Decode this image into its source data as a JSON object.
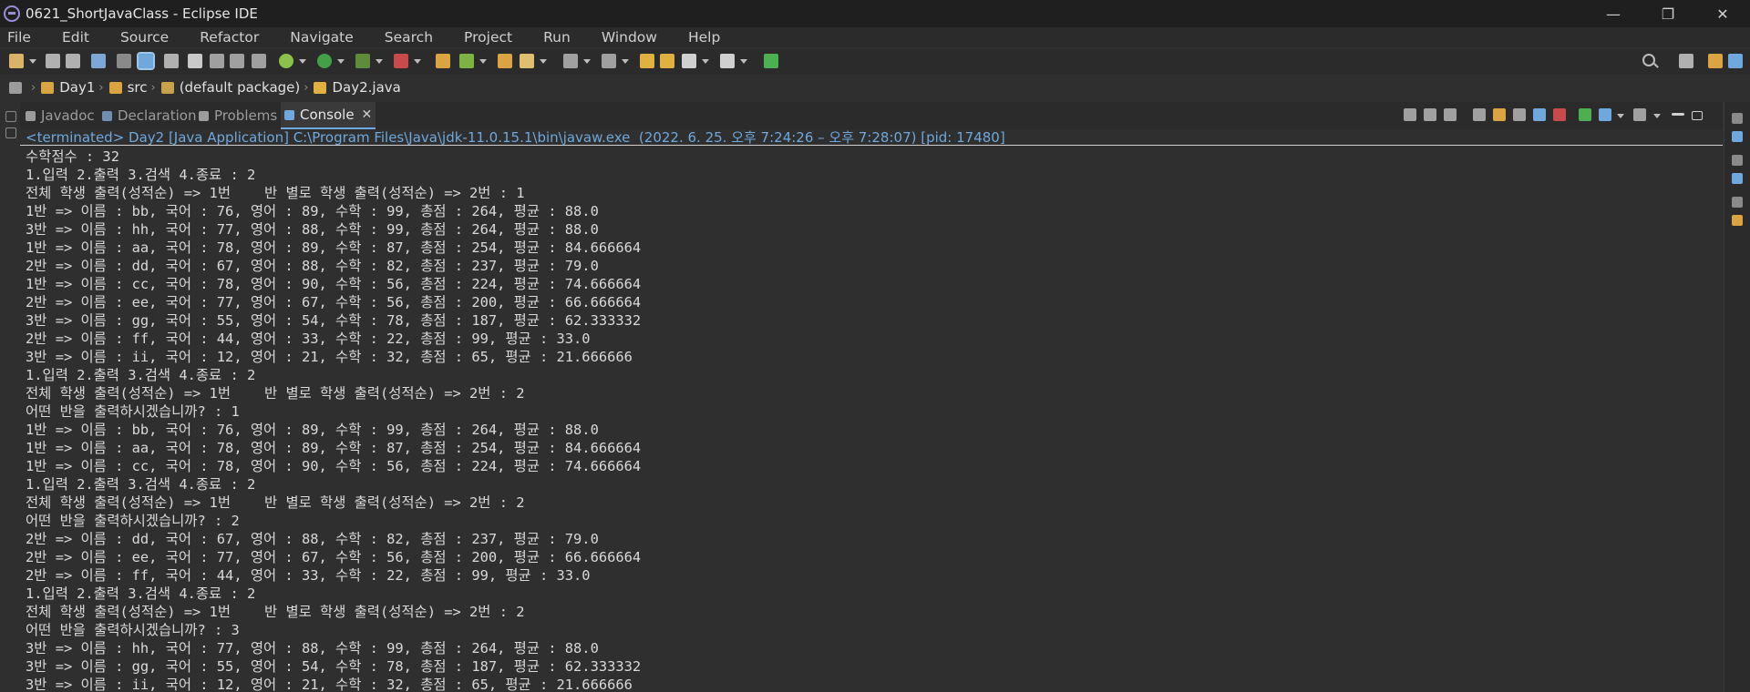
{
  "window": {
    "title": "0621_ShortJavaClass - Eclipse IDE",
    "minimize": "—",
    "maximize": "❐",
    "close": "✕"
  },
  "menu": [
    "File",
    "Edit",
    "Source",
    "Refactor",
    "Navigate",
    "Search",
    "Project",
    "Run",
    "Window",
    "Help"
  ],
  "breadcrumb": [
    {
      "label": "Day1",
      "icon": "java-project-icon"
    },
    {
      "label": "src",
      "icon": "source-folder-icon"
    },
    {
      "label": "(default package)",
      "icon": "package-icon"
    },
    {
      "label": "Day2.java",
      "icon": "java-file-icon"
    }
  ],
  "view_tabs": [
    {
      "label": "Javadoc",
      "icon": "javadoc-icon"
    },
    {
      "label": "Declaration",
      "icon": "declaration-icon"
    },
    {
      "label": "Problems",
      "icon": "problems-icon"
    },
    {
      "label": "Console",
      "icon": "console-icon",
      "active": true
    }
  ],
  "tab_close": "✕",
  "status": "<terminated> Day2 [Java Application] C:\\Program Files\\Java\\jdk-11.0.15.1\\bin\\javaw.exe  (2022. 6. 25. 오후 7:24:26 – 오후 7:28:07) [pid: 17480]",
  "console_lines": [
    "수학점수 : 32",
    "1.입력 2.출력 3.검색 4.종료 : 2",
    "전체 학생 출력(성적순) => 1번    반 별로 학생 출력(성적순) => 2번 : 1",
    "1반 => 이름 : bb, 국어 : 76, 영어 : 89, 수학 : 99, 총점 : 264, 평균 : 88.0",
    "3반 => 이름 : hh, 국어 : 77, 영어 : 88, 수학 : 99, 총점 : 264, 평균 : 88.0",
    "1반 => 이름 : aa, 국어 : 78, 영어 : 89, 수학 : 87, 총점 : 254, 평균 : 84.666664",
    "2반 => 이름 : dd, 국어 : 67, 영어 : 88, 수학 : 82, 총점 : 237, 평균 : 79.0",
    "1반 => 이름 : cc, 국어 : 78, 영어 : 90, 수학 : 56, 총점 : 224, 평균 : 74.666664",
    "2반 => 이름 : ee, 국어 : 77, 영어 : 67, 수학 : 56, 총점 : 200, 평균 : 66.666664",
    "3반 => 이름 : gg, 국어 : 55, 영어 : 54, 수학 : 78, 총점 : 187, 평균 : 62.333332",
    "2반 => 이름 : ff, 국어 : 44, 영어 : 33, 수학 : 22, 총점 : 99, 평균 : 33.0",
    "3반 => 이름 : ii, 국어 : 12, 영어 : 21, 수학 : 32, 총점 : 65, 평균 : 21.666666",
    "1.입력 2.출력 3.검색 4.종료 : 2",
    "전체 학생 출력(성적순) => 1번    반 별로 학생 출력(성적순) => 2번 : 2",
    "어떤 반을 출력하시겠습니까? : 1",
    "1반 => 이름 : bb, 국어 : 76, 영어 : 89, 수학 : 99, 총점 : 264, 평균 : 88.0",
    "1반 => 이름 : aa, 국어 : 78, 영어 : 89, 수학 : 87, 총점 : 254, 평균 : 84.666664",
    "1반 => 이름 : cc, 국어 : 78, 영어 : 90, 수학 : 56, 총점 : 224, 평균 : 74.666664",
    "1.입력 2.출력 3.검색 4.종료 : 2",
    "전체 학생 출력(성적순) => 1번    반 별로 학생 출력(성적순) => 2번 : 2",
    "어떤 반을 출력하시겠습니까? : 2",
    "2반 => 이름 : dd, 국어 : 67, 영어 : 88, 수학 : 82, 총점 : 237, 평균 : 79.0",
    "2반 => 이름 : ee, 국어 : 77, 영어 : 67, 수학 : 56, 총점 : 200, 평균 : 66.666664",
    "2반 => 이름 : ff, 국어 : 44, 영어 : 33, 수학 : 22, 총점 : 99, 평균 : 33.0",
    "1.입력 2.출력 3.검색 4.종료 : 2",
    "전체 학생 출력(성적순) => 1번    반 별로 학생 출력(성적순) => 2번 : 2",
    "어떤 반을 출력하시겠습니까? : 3",
    "3반 => 이름 : hh, 국어 : 77, 영어 : 88, 수학 : 99, 총점 : 264, 평균 : 88.0",
    "3반 => 이름 : gg, 국어 : 55, 영어 : 54, 수학 : 78, 총점 : 187, 평균 : 62.333332",
    "3반 => 이름 : ii, 국어 : 12, 영어 : 21, 수학 : 32, 총점 : 65, 평균 : 21.666666"
  ],
  "colors": {
    "background": "#2f2f2f",
    "status_text": "#6fa8dc",
    "console_text": "#d9d9d9"
  }
}
